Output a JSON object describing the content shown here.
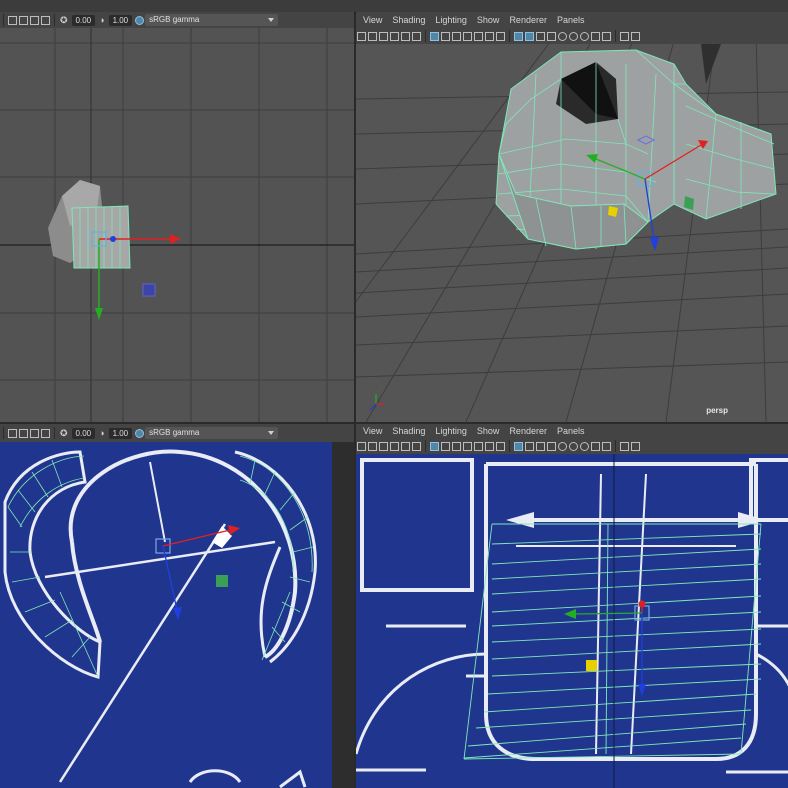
{
  "panels": {
    "top_left": {
      "toolbar": {
        "value_a": "0.00",
        "value_b": "1.00",
        "color_space": "sRGB gamma"
      }
    },
    "top_right": {
      "menu": [
        "View",
        "Shading",
        "Lighting",
        "Show",
        "Renderer",
        "Panels"
      ],
      "camera_label": "persp"
    },
    "bottom_left": {
      "toolbar": {
        "value_a": "0.00",
        "value_b": "1.00",
        "color_space": "sRGB gamma"
      }
    },
    "bottom_right": {
      "menu": [
        "View",
        "Shading",
        "Lighting",
        "Show",
        "Renderer",
        "Panels"
      ]
    }
  },
  "colors": {
    "viewport_bg": "#535353",
    "grid": "#3e3e3e",
    "blueprint_bg": "#20368e",
    "wireframe": "#7ee8b8",
    "axis_x": "#e02020",
    "axis_y": "#22b022",
    "axis_z": "#1f3fe0",
    "selected_icon": "#5285a6"
  }
}
